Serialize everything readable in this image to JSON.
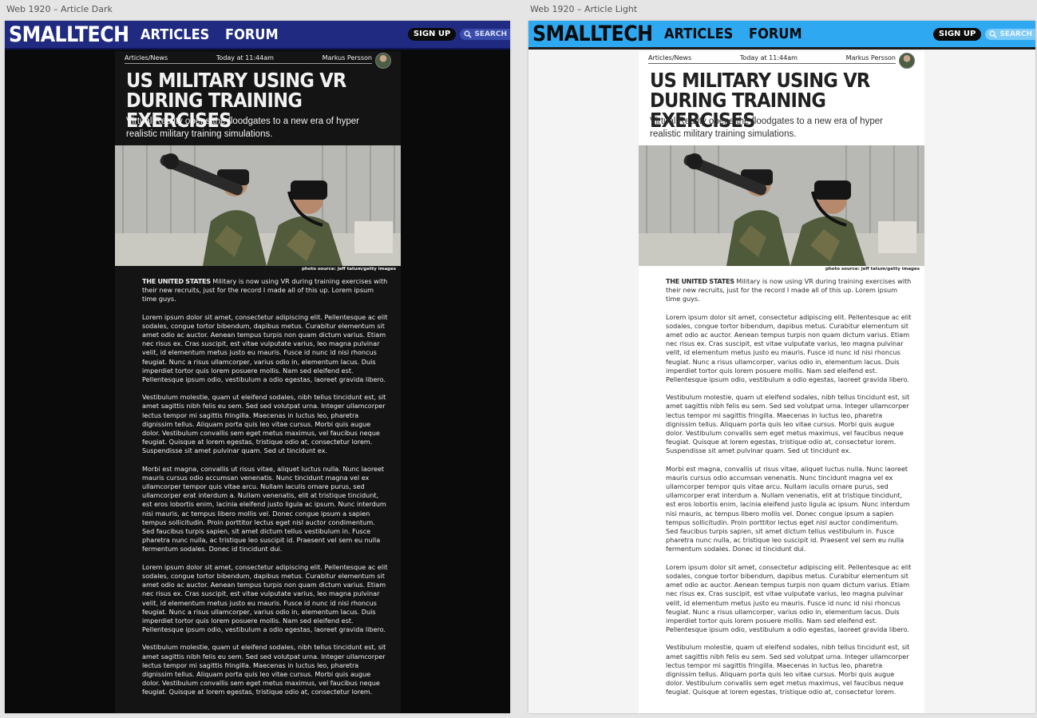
{
  "artboards": {
    "dark_label": "Web 1920 – Article Dark",
    "light_label": "Web 1920 – Article Light"
  },
  "header": {
    "logo": "SMALLTECH",
    "nav_articles": "ARTICLES",
    "nav_forum": "FORUM",
    "signup": "SIGN UP",
    "search": "SEARCH"
  },
  "article": {
    "breadcrumb": "Articles/News",
    "timestamp": "Today at 11:44am",
    "author": "Markus Persson",
    "title": "US MILITARY USING VR DURING TRAINING EXERCISES",
    "subtitle": "Virtual Reality opens the floodgates to a new era of hyper realistic military training simulations.",
    "photo_credit": "photo source: jeff tatum/getty images",
    "lead_label": "THE UNITED STATES",
    "lead_text": " Military is now using VR during training exercises with their new recruits, just for the record I made all of this up. Lorem ipsum time guys.",
    "paragraphs": [
      "Lorem ipsum dolor sit amet, consectetur adipiscing elit. Pellentesque ac elit sodales, congue tortor bibendum, dapibus metus. Curabitur elementum sit amet odio ac auctor. Aenean tempus turpis non quam dictum varius. Etiam nec risus ex. Cras suscipit, est vitae vulputate varius, leo magna pulvinar velit, id elementum metus justo eu mauris. Fusce id nunc id nisi rhoncus feugiat. Nunc a risus ullamcorper, varius odio in, elementum lacus. Duis imperdiet tortor quis lorem posuere mollis. Nam sed eleifend est. Pellentesque ipsum odio, vestibulum a odio egestas, laoreet gravida libero.",
      "Vestibulum molestie, quam ut eleifend sodales, nibh tellus tincidunt est, sit amet sagittis nibh felis eu sem. Sed sed volutpat urna. Integer ullamcorper lectus tempor mi sagittis fringilla. Maecenas in luctus leo, pharetra dignissim tellus. Aliquam porta quis leo vitae cursus. Morbi quis augue dolor. Vestibulum convallis sem eget metus maximus, vel faucibus neque feugiat. Quisque at lorem egestas, tristique odio at, consectetur lorem. Suspendisse sit amet pulvinar quam. Sed ut tincidunt ex.",
      "Morbi est magna, convallis ut risus vitae, aliquet luctus nulla. Nunc laoreet mauris cursus odio accumsan venenatis. Nunc tincidunt magna vel ex ullamcorper tempor quis vitae arcu. Nullam iaculis ornare purus, sed ullamcorper erat interdum a. Nullam venenatis, elit at tristique tincidunt, est eros lobortis enim, lacinia eleifend justo ligula ac ipsum. Nunc interdum nisi mauris, ac tempus libero mollis vel. Donec congue ipsum a sapien tempus sollicitudin. Proin porttitor lectus eget nisl auctor condimentum. Sed faucibus turpis sapien, sit amet dictum tellus vestibulum in. Fusce pharetra nunc nulla, ac tristique leo suscipit id. Praesent vel sem eu nulla fermentum sodales. Donec id tincidunt dui.",
      "Lorem ipsum dolor sit amet, consectetur adipiscing elit. Pellentesque ac elit sodales, congue tortor bibendum, dapibus metus. Curabitur elementum sit amet odio ac auctor. Aenean tempus turpis non quam dictum varius. Etiam nec risus ex. Cras suscipit, est vitae vulputate varius, leo magna pulvinar velit, id elementum metus justo eu mauris. Fusce id nunc id nisi rhoncus feugiat. Nunc a risus ullamcorper, varius odio in, elementum lacus. Duis imperdiet tortor quis lorem posuere mollis. Nam sed eleifend est. Pellentesque ipsum odio, vestibulum a odio egestas, laoreet gravida libero.",
      "Vestibulum molestie, quam ut eleifend sodales, nibh tellus tincidunt est, sit amet sagittis nibh felis eu sem. Sed sed volutpat urna. Integer ullamcorper lectus tempor mi sagittis fringilla. Maecenas in luctus leo, pharetra dignissim tellus. Aliquam porta quis leo vitae cursus. Morbi quis augue dolor. Vestibulum convallis sem eget metus maximus, vel faucibus neque feugiat. Quisque at lorem egestas, tristique odio at, consectetur lorem."
    ]
  },
  "theme": {
    "dark_header": "#1f2a80",
    "light_header": "#2fa8f2",
    "dark_background": "#0a0a0a",
    "light_background": "#ffffff"
  },
  "icons": {
    "search": "search-icon",
    "avatar": "author-avatar"
  }
}
